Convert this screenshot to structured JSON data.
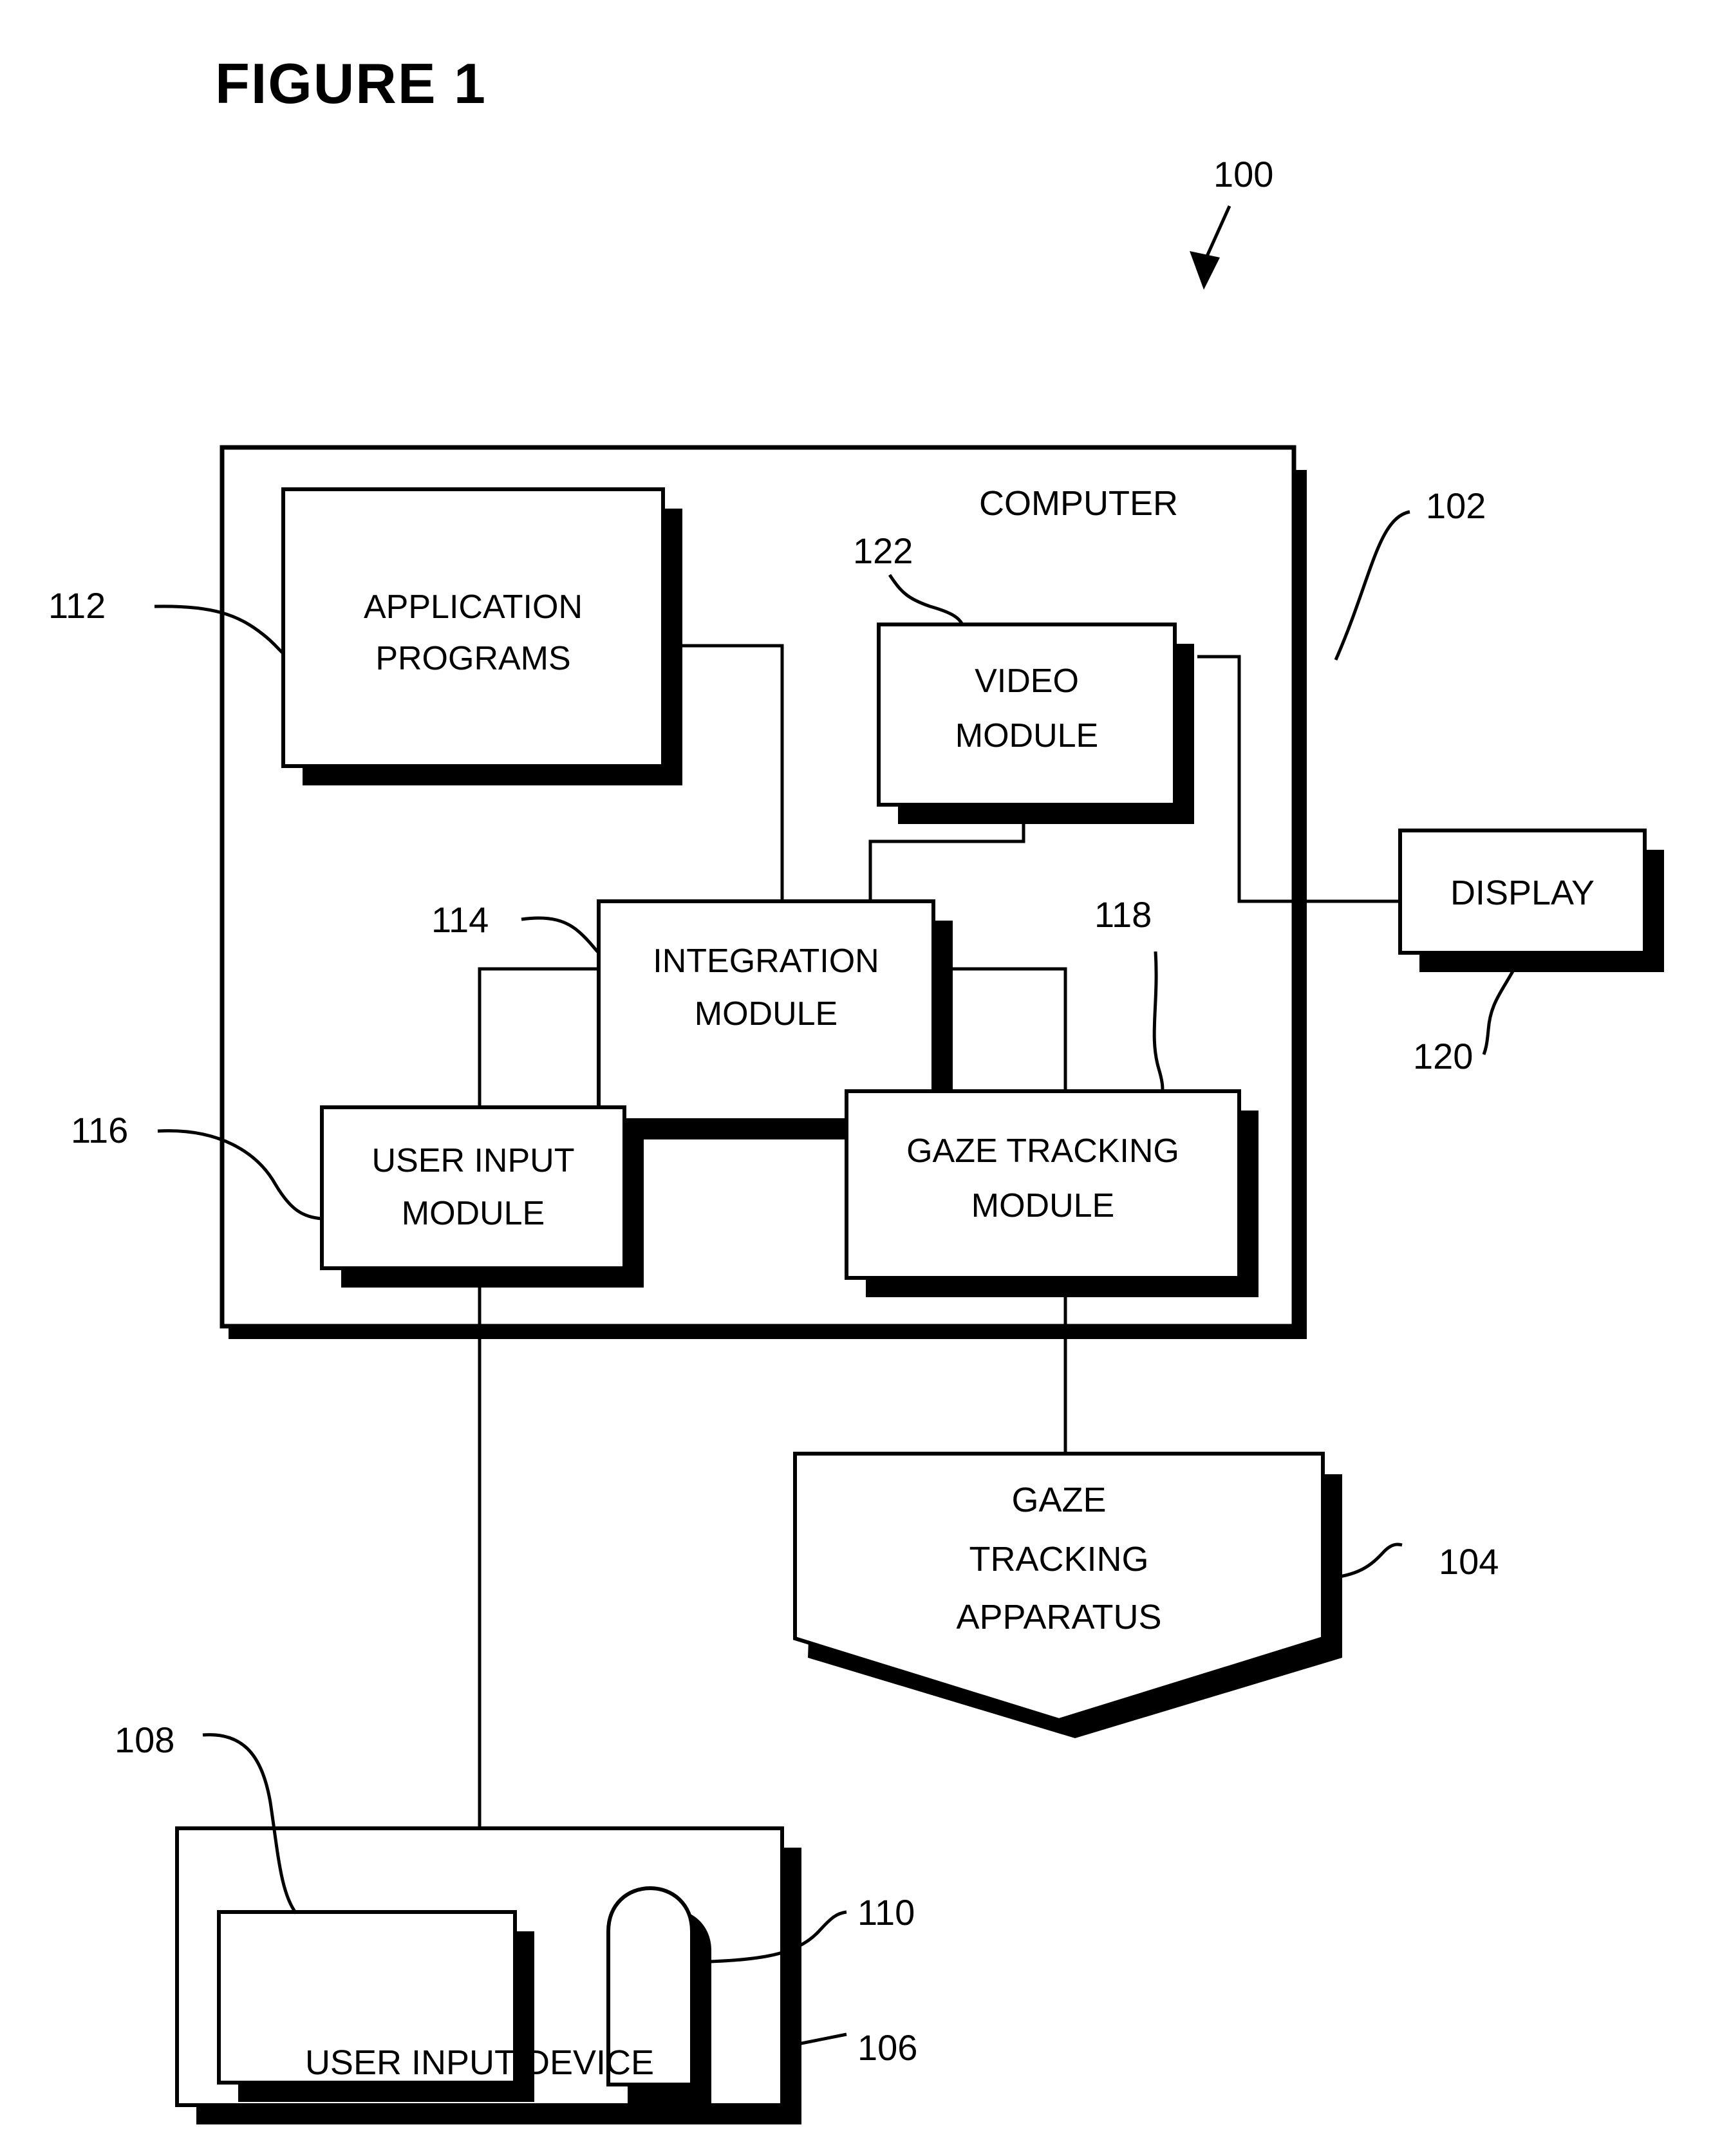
{
  "figure": {
    "title": "FIGURE 1",
    "system_ref": "100"
  },
  "computer": {
    "label": "COMPUTER",
    "ref": "102",
    "modules": [
      {
        "id": "application-programs",
        "lines": [
          "APPLICATION",
          "PROGRAMS"
        ],
        "ref": "112"
      },
      {
        "id": "video-module",
        "lines": [
          "VIDEO",
          "MODULE"
        ],
        "ref": "122"
      },
      {
        "id": "integration-module",
        "lines": [
          "INTEGRATION",
          "MODULE"
        ],
        "ref": "114"
      },
      {
        "id": "user-input-module",
        "lines": [
          "USER INPUT",
          "MODULE"
        ],
        "ref": "116"
      },
      {
        "id": "gaze-tracking-module",
        "lines": [
          "GAZE TRACKING",
          "MODULE"
        ],
        "ref": "118"
      }
    ]
  },
  "peripherals": {
    "display": {
      "label": "DISPLAY",
      "ref": "120"
    },
    "gaze_tracking_apparatus": {
      "lines": [
        "GAZE",
        "TRACKING",
        "APPARATUS"
      ],
      "ref": "104"
    },
    "user_input_device": {
      "label": "USER INPUT DEVICE",
      "ref": "106",
      "keyboard_ref": "108",
      "button_ref": "110"
    }
  },
  "colors": {
    "ink": "#000000",
    "paper": "#ffffff"
  }
}
